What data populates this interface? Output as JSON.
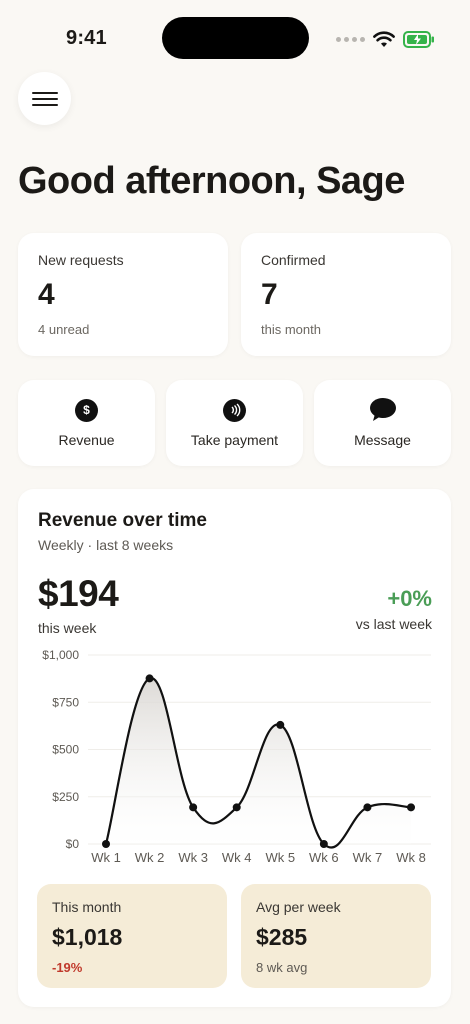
{
  "status": {
    "time": "9:41"
  },
  "greeting": "Good afternoon, Sage",
  "stats": [
    {
      "label": "New requests",
      "value": "4",
      "sub": "4 unread"
    },
    {
      "label": "Confirmed",
      "value": "7",
      "sub": "this month"
    }
  ],
  "actions": [
    {
      "label": "Revenue",
      "icon": "dollar-icon"
    },
    {
      "label": "Take payment",
      "icon": "contactless-icon"
    },
    {
      "label": "Message",
      "icon": "chat-bubble-icon"
    }
  ],
  "revenue": {
    "title": "Revenue over time",
    "subtitle": "Weekly · last 8 weeks",
    "value": "$194",
    "value_sub": "this week",
    "change": "+0%",
    "change_sub": "vs last week",
    "change_color": "#4a9d56"
  },
  "chart_data": {
    "type": "line",
    "categories": [
      "Wk 1",
      "Wk 2",
      "Wk 3",
      "Wk 4",
      "Wk 5",
      "Wk 6",
      "Wk 7",
      "Wk 8"
    ],
    "values": [
      0,
      876,
      194,
      194,
      630,
      0,
      194,
      194
    ],
    "y_ticks": [
      "$0",
      "$250",
      "$500",
      "$750",
      "$1,000"
    ],
    "ylim": [
      0,
      1000
    ],
    "grid": true,
    "line_color": "#111111"
  },
  "summary": [
    {
      "label": "This month",
      "value": "$1,018",
      "sub": "-19%",
      "sub_color": "#c0392b"
    },
    {
      "label": "Avg per week",
      "value": "$285",
      "sub": "8 wk avg"
    }
  ],
  "colors": {
    "background": "#faf8f4",
    "summary_bg": "#f5ecd7"
  }
}
